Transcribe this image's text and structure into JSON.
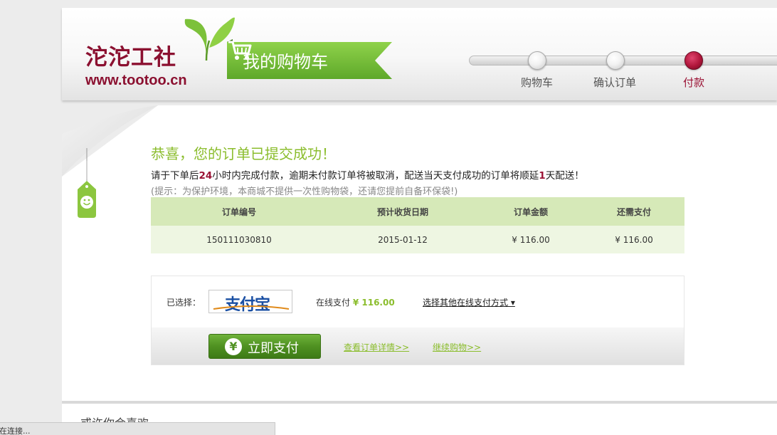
{
  "header": {
    "logo_cn": "沱沱工社",
    "logo_url": "www.tootoo.cn",
    "banner_title": "我的购物车",
    "steps": [
      {
        "label": "购物车",
        "active": false
      },
      {
        "label": "确认订单",
        "active": false
      },
      {
        "label": "付款",
        "active": true
      }
    ]
  },
  "main": {
    "success_title": "恭喜，您的订单已提交成功！",
    "notice": {
      "part1": "请于下单后",
      "hours": "24",
      "part2": "小时内完成付款，逾期未付款订单将被取消，配送当天支付成功的订单将顺延",
      "days": "1",
      "part3": "天配送！"
    },
    "hint": "(提示：为保护环境，本商城不提供一次性购物袋，还请您提前自备环保袋!)",
    "table": {
      "headers": [
        "订单编号",
        "预计收货日期",
        "订单金额",
        "还需支付"
      ],
      "row": [
        "150111030810",
        "2015-01-12",
        "¥ 116.00",
        "¥ 116.00"
      ]
    },
    "payment": {
      "chosen_label": "已选择：",
      "method_logo_text": "支付宝",
      "online_pay_label": "在线支付",
      "online_pay_amount": "¥ 116.00",
      "other_methods": "选择其他在线支付方式 ▾",
      "pay_button": "立即支付",
      "pay_button_icon": "¥",
      "view_order_link": "查看订单详情>>",
      "continue_shopping_link": "继续购物>>"
    }
  },
  "footer": {
    "section_title": "或许你会喜欢"
  },
  "statusbar": {
    "text": "正在连接..."
  },
  "colors": {
    "brand_red": "#8b1030",
    "brand_green": "#8bbd2d",
    "button_green": "#4f9121",
    "table_header_bg": "#d6e9b8",
    "table_row_bg": "#eef6e2"
  }
}
